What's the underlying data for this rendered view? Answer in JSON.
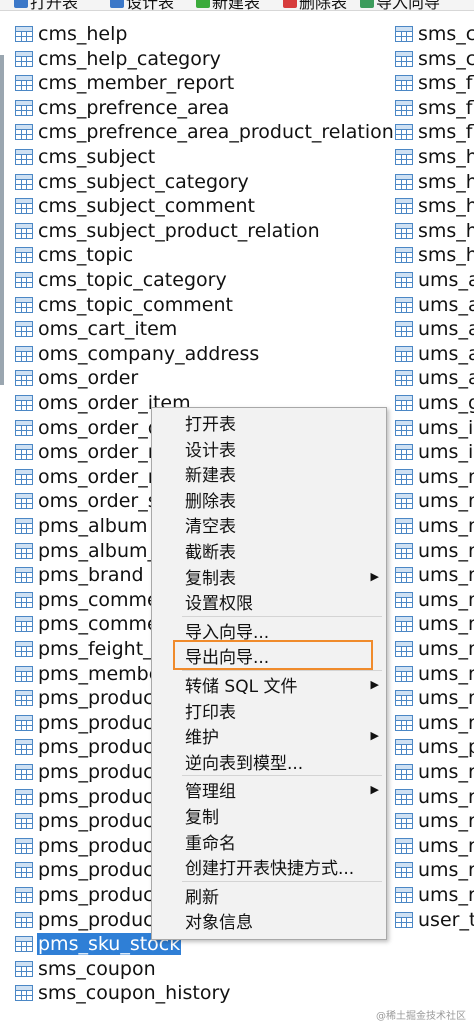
{
  "toolbar": {
    "items": [
      {
        "label": "打开表",
        "color": "#3c78c8"
      },
      {
        "label": "设计表",
        "color": "#3c78c8"
      },
      {
        "label": "新建表",
        "color": "#3cab3c"
      },
      {
        "label": "删除表",
        "color": "#d73c3c"
      },
      {
        "label": "导入向导",
        "color": "#3c9c5c"
      }
    ]
  },
  "left_tables": [
    {
      "name": "cms_help"
    },
    {
      "name": "cms_help_category"
    },
    {
      "name": "cms_member_report"
    },
    {
      "name": "cms_prefrence_area"
    },
    {
      "name": "cms_prefrence_area_product_relation"
    },
    {
      "name": "cms_subject"
    },
    {
      "name": "cms_subject_category"
    },
    {
      "name": "cms_subject_comment"
    },
    {
      "name": "cms_subject_product_relation"
    },
    {
      "name": "cms_topic"
    },
    {
      "name": "cms_topic_category"
    },
    {
      "name": "cms_topic_comment"
    },
    {
      "name": "oms_cart_item"
    },
    {
      "name": "oms_company_address"
    },
    {
      "name": "oms_order"
    },
    {
      "name": "oms_order_item"
    },
    {
      "name": "oms_order_op"
    },
    {
      "name": "oms_order_re"
    },
    {
      "name": "oms_order_re"
    },
    {
      "name": "oms_order_se"
    },
    {
      "name": "pms_album"
    },
    {
      "name": "pms_album_p"
    },
    {
      "name": "pms_brand"
    },
    {
      "name": "pms_commer"
    },
    {
      "name": "pms_commer"
    },
    {
      "name": "pms_feight_te"
    },
    {
      "name": "pms_member"
    },
    {
      "name": "pms_product"
    },
    {
      "name": "pms_product"
    },
    {
      "name": "pms_product"
    },
    {
      "name": "pms_product"
    },
    {
      "name": "pms_product"
    },
    {
      "name": "pms_product"
    },
    {
      "name": "pms_product"
    },
    {
      "name": "pms_product"
    },
    {
      "name": "pms_product"
    },
    {
      "name": "pms_product"
    },
    {
      "name": "pms_sku_stock",
      "selected": true
    },
    {
      "name": "sms_coupon"
    },
    {
      "name": "sms_coupon_history"
    }
  ],
  "right_tables": [
    {
      "name": "sms_co"
    },
    {
      "name": "sms_co"
    },
    {
      "name": "sms_fla"
    },
    {
      "name": "sms_fla"
    },
    {
      "name": "sms_fla"
    },
    {
      "name": "sms_ho"
    },
    {
      "name": "sms_ho"
    },
    {
      "name": "sms_ho"
    },
    {
      "name": "sms_ho"
    },
    {
      "name": "sms_ho"
    },
    {
      "name": "ums_ad"
    },
    {
      "name": "ums_ad"
    },
    {
      "name": "ums_ad"
    },
    {
      "name": "ums_ad"
    },
    {
      "name": "ums_ad"
    },
    {
      "name": "ums_g"
    },
    {
      "name": "ums_in"
    },
    {
      "name": "ums_in"
    },
    {
      "name": "ums_m"
    },
    {
      "name": "ums_m"
    },
    {
      "name": "ums_m"
    },
    {
      "name": "ums_m"
    },
    {
      "name": "ums_m"
    },
    {
      "name": "ums_m"
    },
    {
      "name": "ums_m"
    },
    {
      "name": "ums_m"
    },
    {
      "name": "ums_m"
    },
    {
      "name": "ums_m"
    },
    {
      "name": "ums_m"
    },
    {
      "name": "ums_p"
    },
    {
      "name": "ums_re"
    },
    {
      "name": "ums_re"
    },
    {
      "name": "ums_ro"
    },
    {
      "name": "ums_ro"
    },
    {
      "name": "ums_ro"
    },
    {
      "name": "ums_ro"
    },
    {
      "name": "user_te"
    }
  ],
  "context_menu": {
    "items": [
      {
        "label": "打开表"
      },
      {
        "label": "设计表"
      },
      {
        "label": "新建表"
      },
      {
        "label": "删除表"
      },
      {
        "label": "清空表"
      },
      {
        "label": "截断表"
      },
      {
        "label": "复制表",
        "submenu": true
      },
      {
        "label": "设置权限",
        "sep_after": true
      },
      {
        "label": "导入向导..."
      },
      {
        "label": "导出向导...",
        "highlighted": true,
        "sep_after": true
      },
      {
        "label": "转储 SQL 文件",
        "submenu": true
      },
      {
        "label": "打印表"
      },
      {
        "label": "维护",
        "submenu": true
      },
      {
        "label": "逆向表到模型...",
        "sep_after": true
      },
      {
        "label": "管理组",
        "submenu": true
      },
      {
        "label": "复制"
      },
      {
        "label": "重命名"
      },
      {
        "label": "创建打开表快捷方式...",
        "sep_after": true
      },
      {
        "label": "刷新"
      },
      {
        "label": "对象信息"
      }
    ],
    "submenu_arrow": "▶",
    "highlight_color": "#f08b2c"
  },
  "watermark": "@稀土掘金技术社区"
}
